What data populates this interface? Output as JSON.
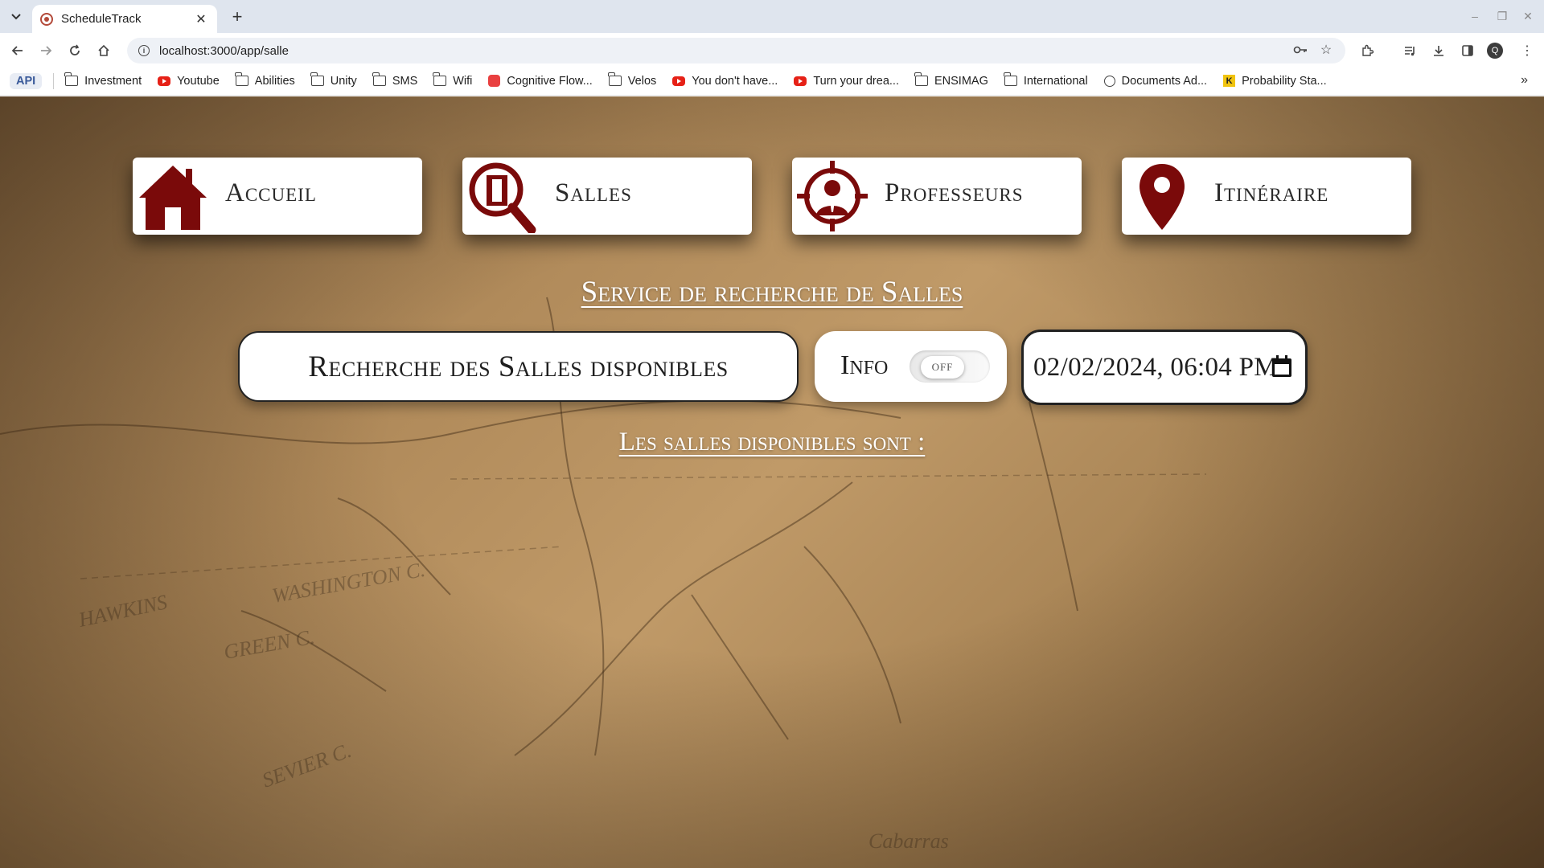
{
  "browser": {
    "tab_title": "ScheduleTrack",
    "url": "localhost:3000/app/salle",
    "profile_initial": "Q",
    "bookmarks": [
      {
        "label": "API",
        "icon": "api-badge"
      },
      {
        "label": "Investment",
        "icon": "folder-icon"
      },
      {
        "label": "Youtube",
        "icon": "youtube-icon"
      },
      {
        "label": "Abilities",
        "icon": "folder-icon"
      },
      {
        "label": "Unity",
        "icon": "folder-icon"
      },
      {
        "label": "SMS",
        "icon": "folder-icon"
      },
      {
        "label": "Wifi",
        "icon": "folder-icon"
      },
      {
        "label": "Cognitive Flow...",
        "icon": "cognitive-icon"
      },
      {
        "label": "Velos",
        "icon": "folder-icon"
      },
      {
        "label": "You don't have...",
        "icon": "youtube-icon"
      },
      {
        "label": "Turn your drea...",
        "icon": "youtube-icon"
      },
      {
        "label": "ENSIMAG",
        "icon": "folder-icon"
      },
      {
        "label": "International",
        "icon": "folder-icon"
      },
      {
        "label": "Documents Ad...",
        "icon": "globe-icon"
      },
      {
        "label": "Probability Sta...",
        "icon": "k-icon"
      }
    ]
  },
  "nav": {
    "home": "Accueil",
    "rooms": "Salles",
    "teachers": "Professeurs",
    "itinerary": "Itinéraire"
  },
  "section_title": "Service de recherche de Salles",
  "search_button": "Recherche des Salles disponibles",
  "info": {
    "label": "Info",
    "toggle_state": "OFF"
  },
  "date_input": "02/02/2024, 06:04 PM",
  "results_title": "Les salles disponibles sont :",
  "colors": {
    "accent": "#7a0a0a",
    "card_bg": "#ffffff"
  }
}
